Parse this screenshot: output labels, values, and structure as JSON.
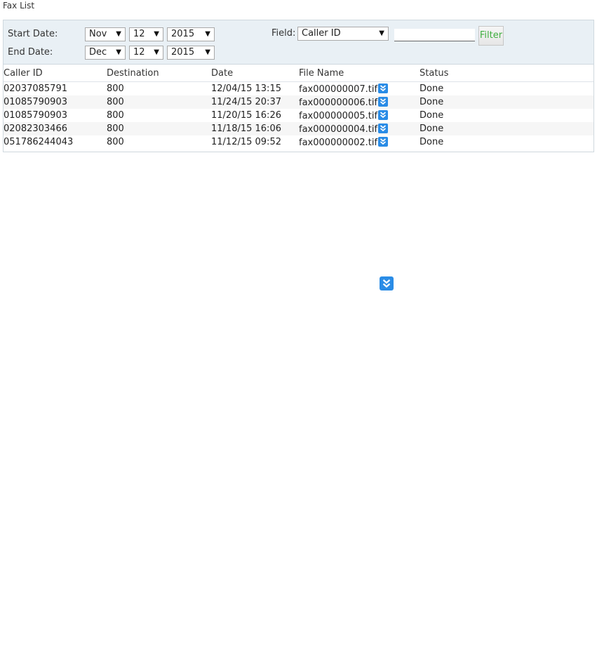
{
  "page": {
    "title": "Fax List"
  },
  "filter": {
    "start_label": "Start Date:",
    "end_label": "End Date:",
    "start_month": "Nov",
    "start_day": "12",
    "start_year": "2015",
    "end_month": "Dec",
    "end_day": "12",
    "end_year": "2015",
    "field_label": "Field:",
    "field_value": "Caller ID",
    "search_value": "",
    "filter_button": "Filter",
    "caret": "▼"
  },
  "table": {
    "headers": [
      "Caller ID",
      "Destination",
      "Date",
      "File Name",
      "Status"
    ],
    "rows": [
      {
        "caller_id": "02037085791",
        "destination": "800",
        "date": "12/04/15 13:15",
        "file_name": "fax000000007.tif",
        "status": "Done"
      },
      {
        "caller_id": "01085790903",
        "destination": "800",
        "date": "11/24/15 20:37",
        "file_name": "fax000000006.tif",
        "status": "Done"
      },
      {
        "caller_id": "01085790903",
        "destination": "800",
        "date": "11/20/15 16:26",
        "file_name": "fax000000005.tif",
        "status": "Done"
      },
      {
        "caller_id": "02082303466",
        "destination": "800",
        "date": "11/18/15 16:06",
        "file_name": "fax000000004.tif",
        "status": "Done"
      },
      {
        "caller_id": "051786244043",
        "destination": "800",
        "date": "11/12/15 09:52",
        "file_name": "fax000000002.tif",
        "status": "Done"
      }
    ]
  },
  "icons": {
    "download": "download-chevrons-icon"
  },
  "colors": {
    "accent": "#2a8ce6",
    "filter_text": "#3fae3f",
    "panel_bg": "#e9f0f5"
  }
}
